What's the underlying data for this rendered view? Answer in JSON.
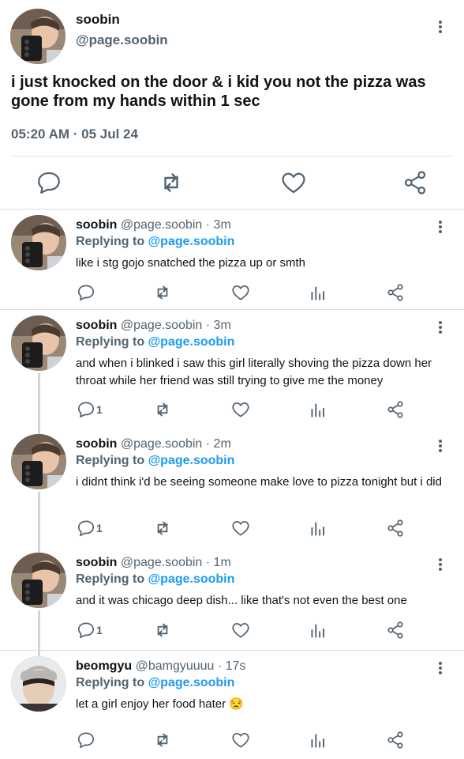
{
  "main_tweet": {
    "name": "soobin",
    "handle": "@page.soobin",
    "text": "i just knocked on the door & i kid you not the pizza was gone from my hands within 1 sec",
    "timestamp": "05:20 AM · 05 Jul 24",
    "actions": [
      "reply-icon",
      "retweet-icon",
      "like-icon",
      "share-icon"
    ]
  },
  "replies": [
    {
      "name": "soobin",
      "meta": "@page.soobin · 3m",
      "replying_label": "Replying to",
      "replying_to": "@page.soobin",
      "text": "like i stg gojo snatched the pizza up or smth",
      "reply_count": ""
    },
    {
      "name": "soobin",
      "meta": "@page.soobin · 3m",
      "replying_label": "Replying to",
      "replying_to": "@page.soobin",
      "text": "and when i blinked i saw this girl literally shoving the pizza down her throat while her friend was still trying to give me the money",
      "reply_count": "1"
    },
    {
      "name": "soobin",
      "meta": "@page.soobin · 2m",
      "replying_label": "Replying to",
      "replying_to": "@page.soobin",
      "text": "i didnt think i'd be seeing someone make love to pizza tonight but i did",
      "reply_count": "1"
    },
    {
      "name": "soobin",
      "meta": "@page.soobin · 1m",
      "replying_label": "Replying to",
      "replying_to": "@page.soobin",
      "text": "and it was chicago deep dish... like that's not even the best one",
      "reply_count": "1"
    },
    {
      "name": "beomgyu",
      "meta": "@bamgyuuuu · 17s",
      "replying_label": "Replying to",
      "replying_to": "@page.soobin",
      "text": "let a girl enjoy her food hater 😒",
      "reply_count": ""
    }
  ],
  "colors": {
    "text": "#0f1419",
    "muted": "#536471",
    "accent": "#1d9bf0",
    "divider": "#e2e6e9"
  }
}
